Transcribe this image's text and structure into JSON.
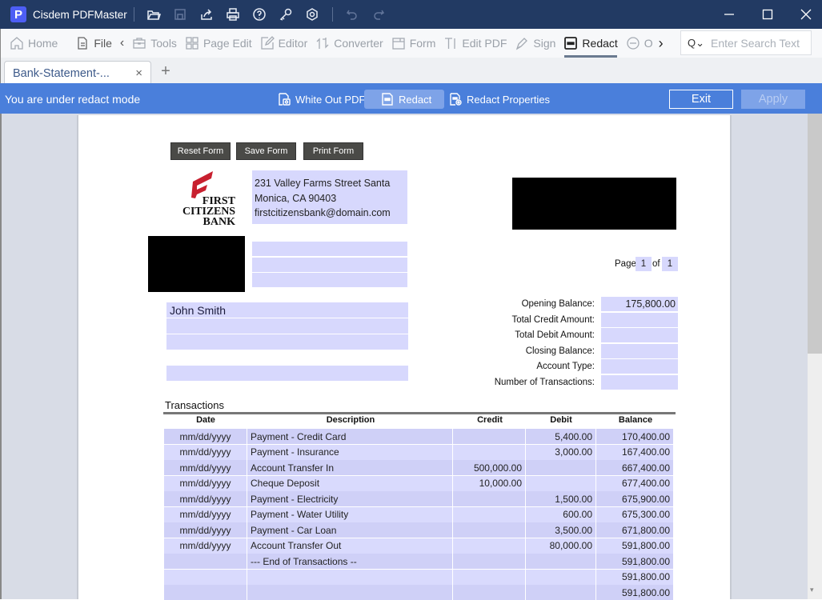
{
  "app": {
    "title": "Cisdem PDFMaster",
    "logo_letter": "P",
    "title_icons": [
      "open-folder-icon",
      "save-icon",
      "share-icon",
      "print-icon",
      "help-icon",
      "key-icon",
      "settings-icon",
      "undo-icon",
      "redo-icon"
    ],
    "window_controls": [
      "minimize",
      "maximize",
      "close"
    ]
  },
  "toolbar": {
    "items": [
      {
        "label": "Home",
        "icon": "home-icon"
      },
      {
        "label": "File",
        "icon": "file-icon"
      },
      {
        "label": "Tools",
        "icon": "toolbox-icon"
      },
      {
        "label": "Page Edit",
        "icon": "grid-icon"
      },
      {
        "label": "Editor",
        "icon": "edit-icon"
      },
      {
        "label": "Converter",
        "icon": "convert-icon"
      },
      {
        "label": "Form",
        "icon": "form-icon"
      },
      {
        "label": "Edit PDF",
        "icon": "text-cursor-icon"
      },
      {
        "label": "Sign",
        "icon": "pen-icon"
      },
      {
        "label": "Redact",
        "icon": "redact-icon",
        "active": true
      },
      {
        "label": "O",
        "icon": "ocr-icon"
      }
    ],
    "search_placeholder": "Enter Search Text"
  },
  "tabs": [
    {
      "label": "Bank-Statement-...",
      "close": "×"
    }
  ],
  "tab_add": "+",
  "redact_bar": {
    "message": "You are under redact mode",
    "white_out": "White Out PDF",
    "redact": "Redact",
    "properties": "Redact Properties",
    "exit": "Exit",
    "apply": "Apply"
  },
  "document": {
    "form_buttons": [
      "Reset Form",
      "Save Form",
      "Print Form"
    ],
    "bank_logo": {
      "line1": "FIRST",
      "line2": "CITIZENS",
      "line3": "BANK",
      "accent": "#c8202f"
    },
    "address": [
      "231 Valley Farms Street Santa",
      "Monica, CA 90403",
      "firstcitizensbank@domain.com"
    ],
    "page_label": "Page",
    "page_current": "1",
    "page_of": "of",
    "page_total": "1",
    "customer_name": "John Smith",
    "summary": [
      {
        "label": "Opening Balance:",
        "value": "175,800.00"
      },
      {
        "label": "Total Credit Amount:",
        "value": ""
      },
      {
        "label": "Total Debit Amount:",
        "value": ""
      },
      {
        "label": "Closing Balance:",
        "value": ""
      },
      {
        "label": "Account Type:",
        "value": ""
      },
      {
        "label": "Number of Transactions:",
        "value": ""
      }
    ],
    "transactions_title": "Transactions",
    "columns": [
      "Date",
      "Description",
      "Credit",
      "Debit",
      "Balance"
    ],
    "rows": [
      [
        "mm/dd/yyyy",
        "Payment - Credit Card",
        "",
        "5,400.00",
        "170,400.00"
      ],
      [
        "mm/dd/yyyy",
        "Payment - Insurance",
        "",
        "3,000.00",
        "167,400.00"
      ],
      [
        "mm/dd/yyyy",
        "Account Transfer In",
        "500,000.00",
        "",
        "667,400.00"
      ],
      [
        "mm/dd/yyyy",
        "Cheque Deposit",
        "10,000.00",
        "",
        "677,400.00"
      ],
      [
        "mm/dd/yyyy",
        "Payment - Electricity",
        "",
        "1,500.00",
        "675,900.00"
      ],
      [
        "mm/dd/yyyy",
        "Payment - Water Utility",
        "",
        "600.00",
        "675,300.00"
      ],
      [
        "mm/dd/yyyy",
        "Payment - Car Loan",
        "",
        "3,500.00",
        "671,800.00"
      ],
      [
        "mm/dd/yyyy",
        "Account Transfer Out",
        "",
        "80,000.00",
        "591,800.00"
      ],
      [
        "",
        "--- End of Transactions --",
        "",
        "",
        "591,800.00"
      ],
      [
        "",
        "",
        "",
        "",
        "591,800.00"
      ],
      [
        "",
        "",
        "",
        "",
        "591,800.00"
      ]
    ]
  }
}
